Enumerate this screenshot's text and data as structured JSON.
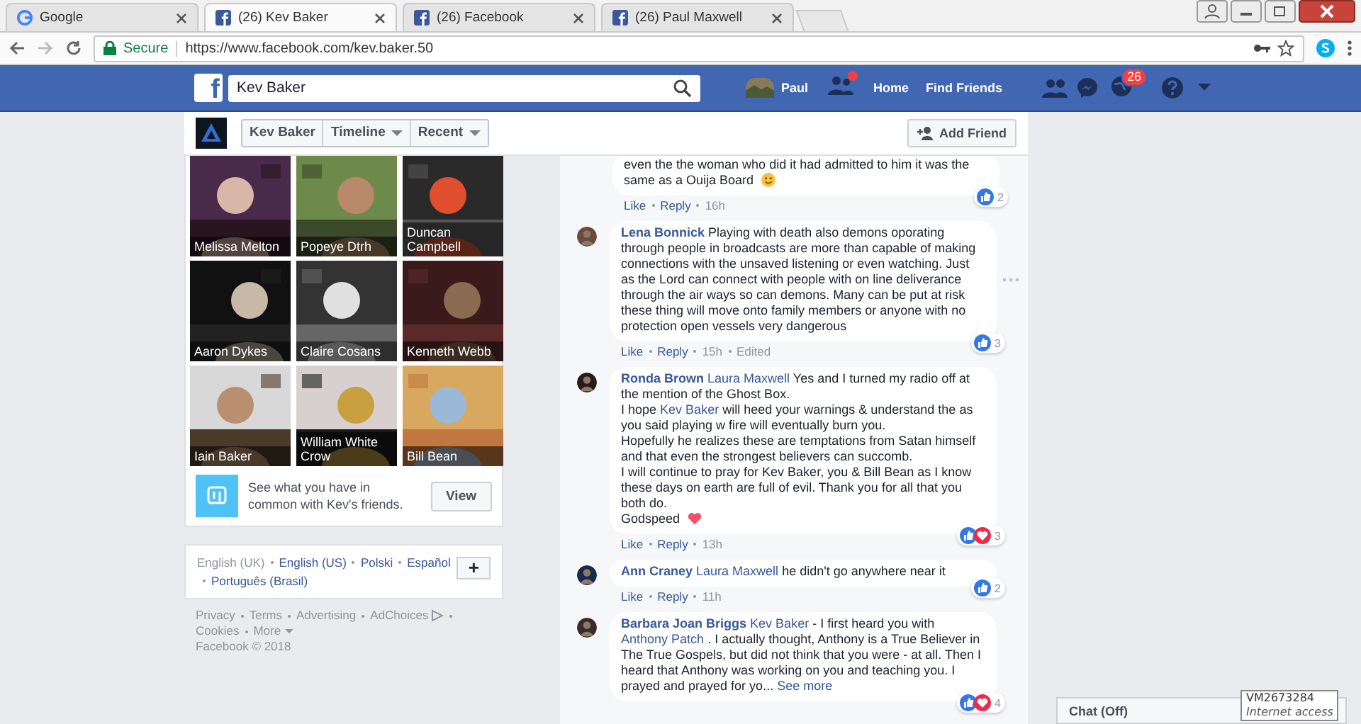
{
  "browser": {
    "tabs": [
      {
        "title": "Google",
        "selected": false
      },
      {
        "title": "(26) Kev Baker",
        "selected": true
      },
      {
        "title": "(26) Facebook",
        "selected": false
      },
      {
        "title": "(26) Paul Maxwell",
        "selected": false
      }
    ],
    "security": "Secure",
    "url": "https://www.facebook.com/kev.baker.50"
  },
  "header": {
    "logo": "f",
    "search": {
      "value": "Kev Baker"
    },
    "user": "Paul",
    "friend_request_alert": true,
    "nav": [
      "Home",
      "Find Friends"
    ],
    "notifications": "26"
  },
  "profile_nav": {
    "name": "Kev Baker",
    "menus": [
      "Timeline",
      "Recent"
    ],
    "add_friend": "Add Friend"
  },
  "friends": [
    {
      "name": "Melissa Melton"
    },
    {
      "name": "Popeye Dtrh"
    },
    {
      "name": "Duncan Campbell"
    },
    {
      "name": "Aaron Dykes"
    },
    {
      "name": "Claire Cosans"
    },
    {
      "name": "Kenneth Webb"
    },
    {
      "name": "Iain Baker"
    },
    {
      "name": "William White Crow"
    },
    {
      "name": "Bill Bean"
    }
  ],
  "common": {
    "text": "See what you have in common with Kev's friends.",
    "button": "View"
  },
  "languages": [
    {
      "label": "English (UK)",
      "selected": true
    },
    {
      "label": "English (US)",
      "selected": false
    },
    {
      "label": "Polski",
      "selected": false
    },
    {
      "label": "Español",
      "selected": false
    },
    {
      "label": "Português (Brasil)",
      "selected": false
    }
  ],
  "language_more": "+",
  "footer_links": [
    "Privacy",
    "Terms",
    "Advertising",
    "AdChoices",
    "Cookies",
    "More"
  ],
  "copyright": "Facebook © 2018",
  "comments": [
    {
      "lines": [
        [
          {
            "kind": "text",
            "text": "even the the woman who did it had admitted to him it was the same as a Ouija Board"
          },
          {
            "kind": "smiley"
          }
        ]
      ],
      "actions": [
        "Like",
        "Reply"
      ],
      "time": "16h",
      "reactions": {
        "kind": "like",
        "count": "2"
      }
    },
    {
      "author": "Lena Bonnick",
      "lines": [
        [
          {
            "kind": "text",
            "text": "Playing with death also demons oporating through people in broadcasts are more than capable of making connections with the unsaved listening or even watching. Just as the Lord can connect with people with on line deliverance through the air ways so can demons. Many can be put at risk these thing will move onto family members or anyone with no protection open vessels very dangerous"
          }
        ]
      ],
      "actions": [
        "Like",
        "Reply"
      ],
      "time": "15h",
      "edited": "Edited",
      "reactions": {
        "kind": "like",
        "count": "3"
      }
    },
    {
      "author": "Ronda Brown",
      "lines": [
        [
          {
            "kind": "mention",
            "text": "Laura Maxwell"
          },
          {
            "kind": "text",
            "text": "Yes and I turned my radio off at the mention of the Ghost Box."
          }
        ],
        [
          {
            "kind": "text",
            "text": "I hope"
          },
          {
            "kind": "mention",
            "text": "Kev Baker"
          },
          {
            "kind": "text",
            "text": "will heed your warnings & understand the as you said playing w fire will eventually burn you."
          }
        ],
        [
          {
            "kind": "text",
            "text": "Hopefully he realizes these are temptations from Satan himself and that even the strongest believers can succomb."
          }
        ],
        [
          {
            "kind": "text",
            "text": "I will continue to pray for Kev Baker, you & Bill Bean as I know these days on earth are full of evil. Thank you for all that you both do."
          }
        ],
        [
          {
            "kind": "text",
            "text": "Godspeed"
          },
          {
            "kind": "heart"
          }
        ]
      ],
      "actions": [
        "Like",
        "Reply"
      ],
      "time": "13h",
      "reactions": {
        "kind": "like-love",
        "count": "3"
      }
    },
    {
      "author": "Ann Craney",
      "lines": [
        [
          {
            "kind": "mention",
            "text": "Laura Maxwell"
          },
          {
            "kind": "text",
            "text": "he didn't go anywhere near it"
          }
        ]
      ],
      "actions": [
        "Like",
        "Reply"
      ],
      "time": "11h",
      "reactions": {
        "kind": "like",
        "count": "2"
      }
    },
    {
      "author": "Barbara Joan Briggs",
      "lines": [
        [
          {
            "kind": "mention",
            "text": "Kev Baker"
          },
          {
            "kind": "text",
            "text": "- I first heard you with"
          },
          {
            "kind": "mention",
            "text": "Anthony Patch"
          },
          {
            "kind": "text",
            "text": ". I actually thought, Anthony is a True Believer in The True Gospels, but did not think that you were - at all. Then I heard that Anthony was working on you and teaching you. I prayed and prayed for yo..."
          },
          {
            "kind": "more",
            "text": "See more"
          }
        ]
      ],
      "reactions": {
        "kind": "like-love",
        "count": "4"
      }
    }
  ],
  "chat": {
    "label": "Chat (Off)"
  },
  "tooltip": {
    "title": "VM2673284",
    "subtitle": "Internet access"
  }
}
